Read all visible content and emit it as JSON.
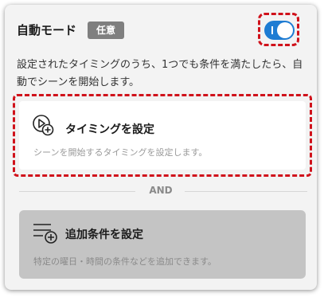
{
  "auto_mode": {
    "title": "自動モード",
    "badge": "任意",
    "toggle_on": true,
    "description": "設定されたタイミングのうち、1つでも条件を満たしたら、自動でシーンを開始します。"
  },
  "timing_card": {
    "icon": "play-circle-plus-icon",
    "title": "タイミングを設定",
    "subtitle": "シーンを開始するタイミングを設定します。"
  },
  "separator": {
    "label": "AND"
  },
  "condition_card": {
    "icon": "list-plus-icon",
    "title": "追加条件を設定",
    "subtitle": "特定の曜日・時間の条件などを追加できます。"
  },
  "colors": {
    "toggle_accent": "#1e7cd3",
    "highlight": "#d0121b",
    "badge": "#7f7f7f"
  }
}
